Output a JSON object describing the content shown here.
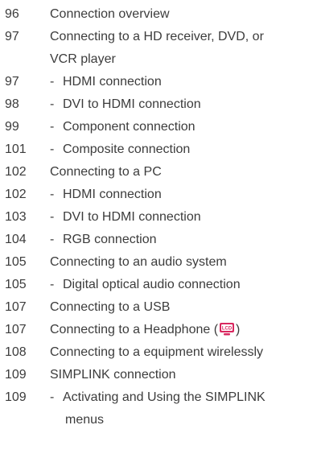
{
  "toc": {
    "entries": [
      {
        "page": "96",
        "text": "Connection overview",
        "sub": false
      },
      {
        "page": "97",
        "text": "Connecting to a HD receiver, DVD, or",
        "cont": "VCR player",
        "sub": false
      },
      {
        "page": "97",
        "text": "HDMI connection",
        "sub": true
      },
      {
        "page": "98",
        "text": "DVI to HDMI connection",
        "sub": true
      },
      {
        "page": "99",
        "text": "Component connection",
        "sub": true
      },
      {
        "page": "101",
        "text": "Composite connection",
        "sub": true
      },
      {
        "page": "102",
        "text": "Connecting to a PC",
        "sub": false
      },
      {
        "page": "102",
        "text": "HDMI connection",
        "sub": true
      },
      {
        "page": "103",
        "text": "DVI to HDMI connection",
        "sub": true
      },
      {
        "page": "104",
        "text": "RGB connection",
        "sub": true
      },
      {
        "page": "105",
        "text": "Connecting to an audio system",
        "sub": false
      },
      {
        "page": "105",
        "text": "Digital optical audio connection",
        "sub": true
      },
      {
        "page": "107",
        "text": "Connecting to a USB",
        "sub": false
      },
      {
        "page": "107",
        "text": "Connecting to a Headphone (",
        "after": ")",
        "badge": "LCD",
        "sub": false
      },
      {
        "page": "108",
        "text": "Connecting to a equipment wirelessly",
        "sub": false
      },
      {
        "page": "109",
        "text": "SIMPLINK connection",
        "sub": false
      },
      {
        "page": "109",
        "text": "Activating and Using the SIMPLINK",
        "cont": "menus",
        "sub": true
      }
    ],
    "sub_prefix": "-"
  },
  "colors": {
    "text": "#3c3c3c",
    "badge": "#d9275f"
  },
  "icons": {
    "headphone_badge": "lcd-tv-icon"
  }
}
